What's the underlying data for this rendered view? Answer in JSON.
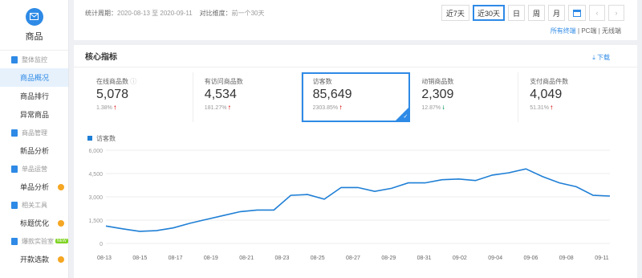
{
  "sidebar": {
    "title": "商品",
    "groups": [
      {
        "label": "整体监控",
        "items": [
          {
            "label": "商品概况",
            "active": true
          },
          {
            "label": "商品排行"
          },
          {
            "label": "异常商品"
          }
        ]
      },
      {
        "label": "商品管理",
        "items": [
          {
            "label": "新品分析"
          }
        ]
      },
      {
        "label": "单品运营",
        "items": [
          {
            "label": "单品分析",
            "dot": true
          }
        ]
      },
      {
        "label": "相关工具",
        "items": [
          {
            "label": "标题优化",
            "dot": true
          }
        ]
      },
      {
        "label": "爆款实验室",
        "badge": "NEW",
        "items": [
          {
            "label": "开款选款",
            "dot": true
          }
        ]
      }
    ]
  },
  "topbar": {
    "period_label": "统计周期：",
    "period_value": "2020-08-13 至 2020-09-11",
    "compare_label": "对比维度：",
    "compare_value": "前一个30天",
    "buttons": [
      "近7天",
      "近30天",
      "日",
      "周",
      "月"
    ],
    "active_button": "近30天",
    "terminals": {
      "all": "所有终端",
      "pc": "PC端",
      "wireless": "无线端"
    }
  },
  "card": {
    "title": "核心指标",
    "download": "下载"
  },
  "metrics": [
    {
      "label": "在线商品数",
      "value": "5,078",
      "change": "1.38%",
      "dir": "up",
      "info": true
    },
    {
      "label": "有访问商品数",
      "value": "4,534",
      "change": "181.27%",
      "dir": "up"
    },
    {
      "label": "访客数",
      "value": "85,649",
      "change": "2303.85%",
      "dir": "up",
      "selected": true
    },
    {
      "label": "动销商品数",
      "value": "2,309",
      "change": "12.87%",
      "dir": "down"
    },
    {
      "label": "支付商品件数",
      "value": "4,049",
      "change": "51.31%",
      "dir": "up"
    }
  ],
  "chart_data": {
    "type": "line",
    "legend": "访客数",
    "color": "#1f7fd6",
    "ylim": [
      0,
      6000
    ],
    "yticks": [
      "6,000",
      "4,500",
      "3,000",
      "1,500",
      "0"
    ],
    "xtick_labels": [
      "08-13",
      "08-15",
      "08-17",
      "08-19",
      "08-21",
      "08-23",
      "08-25",
      "08-27",
      "08-29",
      "08-31",
      "09-02",
      "09-04",
      "09-06",
      "09-08",
      "09-11"
    ],
    "x": [
      "08-13",
      "08-14",
      "08-15",
      "08-16",
      "08-17",
      "08-18",
      "08-19",
      "08-20",
      "08-21",
      "08-22",
      "08-23",
      "08-24",
      "08-25",
      "08-26",
      "08-27",
      "08-28",
      "08-29",
      "08-30",
      "08-31",
      "09-01",
      "09-02",
      "09-03",
      "09-04",
      "09-05",
      "09-06",
      "09-07",
      "09-08",
      "09-09",
      "09-10",
      "09-11"
    ],
    "series": [
      {
        "name": "访客数",
        "values": [
          1120,
          940,
          780,
          820,
          1000,
          1300,
          1550,
          1800,
          2050,
          2150,
          2150,
          3100,
          3150,
          2850,
          3600,
          3600,
          3350,
          3550,
          3900,
          3900,
          4100,
          4150,
          4050,
          4400,
          4550,
          4800,
          4300,
          3900,
          3650,
          3100,
          3050
        ]
      }
    ]
  }
}
